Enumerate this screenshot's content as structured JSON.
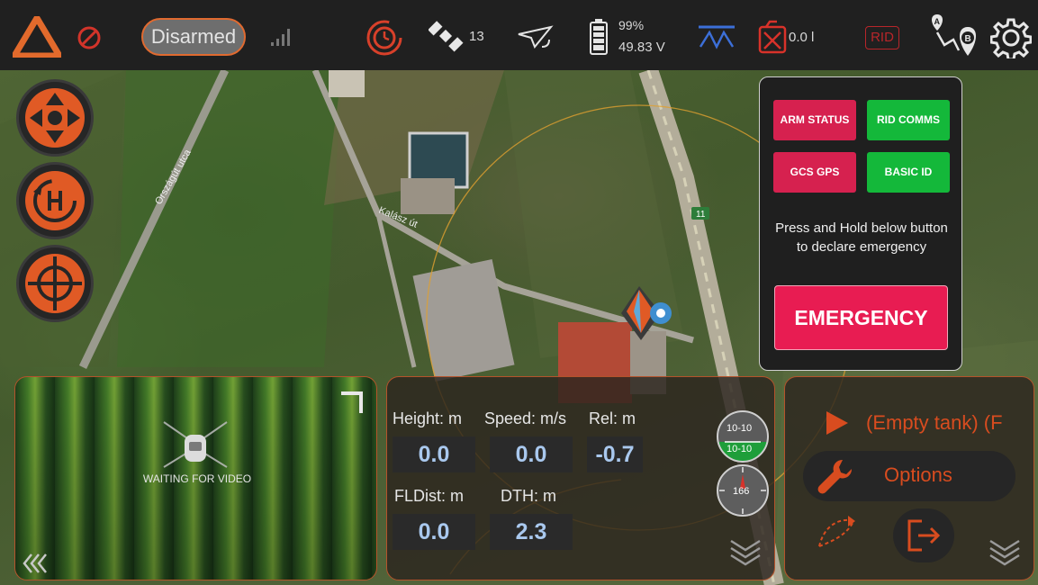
{
  "topbar": {
    "arm_status": "Disarmed",
    "satellite_count": "13",
    "battery_percent": "99%",
    "battery_voltage": "49.83 V",
    "fuel_level": "0.0 l",
    "rid_badge": "RID",
    "icons": [
      "app-logo-icon",
      "no-entry-icon",
      "signal-bars-icon",
      "timer-icon",
      "satellite-icon",
      "aircraft-link-icon",
      "battery-icon",
      "spray-icon",
      "fuel-can-icon",
      "route-ab-icon",
      "settings-gear-icon"
    ]
  },
  "map": {
    "street_label_1": "Országút utca",
    "street_label_2": "Kalász út",
    "road_number": "11"
  },
  "left_buttons": [
    "dpad-icon",
    "home-h-icon",
    "target-icon"
  ],
  "rid_panel": {
    "chips": [
      {
        "label": "ARM STATUS",
        "color": "#d6214f"
      },
      {
        "label": "RID COMMS",
        "color": "#14b83a"
      },
      {
        "label": "GCS GPS",
        "color": "#d6214f"
      },
      {
        "label": "BASIC ID",
        "color": "#14b83a"
      }
    ],
    "message": "Press and Hold below button to declare emergency",
    "emergency_label": "EMERGENCY"
  },
  "video": {
    "status": "WAITING FOR VIDEO"
  },
  "telemetry": {
    "height_label": "Height: m",
    "speed_label": "Speed: m/s",
    "rel_label": "Rel: m",
    "height_value": "0.0",
    "speed_value": "0.0",
    "rel_value": "-0.7",
    "fldist_label": "FLDist: m",
    "dth_label": "DTH: m",
    "fldist_value": "0.0",
    "dth_value": "2.3",
    "attitude_readout": "10-10",
    "heading_readout": "166"
  },
  "mission": {
    "tank_status": "(Empty tank)  (F",
    "options_label": "Options"
  },
  "colors": {
    "accent_orange": "#d84c1f",
    "status_red": "#d6214f",
    "status_green": "#14b83a",
    "emergency": "#e81c52",
    "value_blue": "#a9c8ee"
  }
}
